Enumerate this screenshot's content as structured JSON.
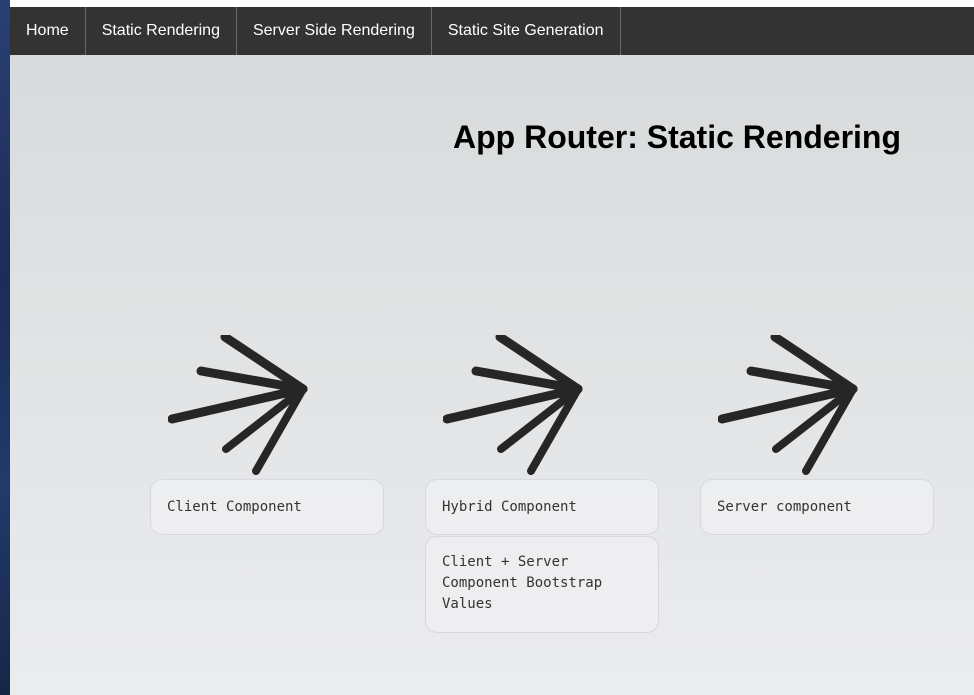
{
  "navbar": {
    "items": [
      {
        "label": "Home"
      },
      {
        "label": "Static Rendering"
      },
      {
        "label": "Server Side Rendering"
      },
      {
        "label": "Static Site Generation"
      }
    ]
  },
  "main": {
    "title": "App Router: Static Rendering",
    "logo_icon": "asterisk-burst-logo-icon",
    "cards": {
      "client": "Client Component",
      "hybrid": "Hybrid Component",
      "hybrid_detail": "Client + Server Component Bootstrap Values",
      "server": "Server component"
    }
  },
  "colors": {
    "navbar_bg": "#333333",
    "nav_text": "#ffffff",
    "page_bg": "#e0e2e3",
    "title_text": "#000000",
    "logo": "#262626",
    "card_bg": "#eeeff1"
  }
}
